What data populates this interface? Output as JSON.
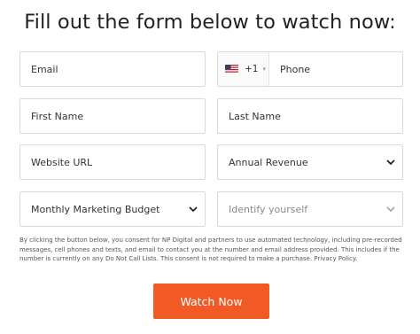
{
  "heading": "Fill out the form below to watch now:",
  "fields": {
    "email": {
      "placeholder": "Email"
    },
    "phone": {
      "country_code": "+1",
      "country_icon": "us-flag-icon",
      "placeholder": "Phone"
    },
    "first_name": {
      "placeholder": "First Name"
    },
    "last_name": {
      "placeholder": "Last Name"
    },
    "website": {
      "placeholder": "Website URL"
    },
    "annual_revenue": {
      "selected": "Annual Revenue"
    },
    "marketing_budget": {
      "selected": "Monthly Marketing Budget"
    },
    "identify": {
      "selected": "Identify yourself"
    }
  },
  "consent_text": "By clicking the button below, you consent for NP Digital and partners to use automated technology, including pre-recorded messages, cell phones and texts, and email to contact you at the number and email address provided. This includes if the number is currently on any Do Not Call Lists. This consent is not required to make a purchase. Privacy Policy.",
  "submit_label": "Watch Now",
  "colors": {
    "accent": "#f15a24",
    "border": "#d9d9d9",
    "text": "#333333"
  }
}
